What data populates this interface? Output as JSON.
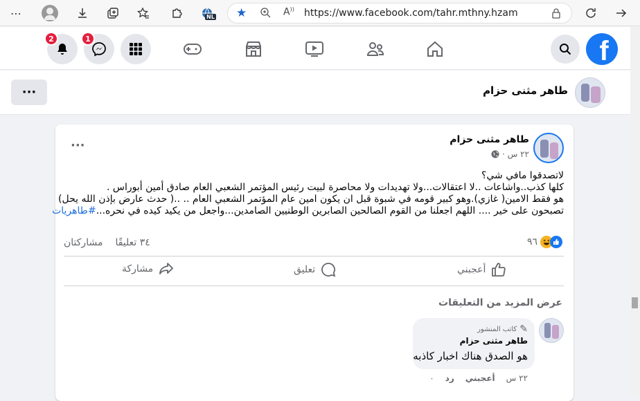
{
  "browser": {
    "url": "https://www.facebook.com/tahr.mthny.hzam",
    "lang_badge": "NL"
  },
  "fb_nav": {
    "notifications_count": "2",
    "messenger_count": "1"
  },
  "profile_header": {
    "name": "طاهر مثنى حزام",
    "more_label": "···"
  },
  "post": {
    "author": "طاهر مثنى حزام",
    "time": "٢٢ س ·",
    "more_label": "···",
    "lines": [
      "لاتصدقوا مافي شي؟",
      "كلها كذب..واشاعات ..لا اعتقالات...ولا تهديدات ولا محاصرة لبيت رئيس المؤتمر الشعبي العام صادق أمين أبوراس .",
      "هو فقط الامين( غازي).وهو كبير قومه في شبوة  قبل ان يكون امين عام المؤتمر الشعبي العام .. ..( حدث عارض بإذن الله يحل)",
      "تصبحون على خير .... اللهم اجعلنا من القوم  الصالحين الصابرين الوطنيين الصامدين...واجعل من يكيد كيده في نحره..."
    ],
    "hashtag": "#طاهريات",
    "reactions_count": "٩٦",
    "comments_count": "٣٤ تعليقًا",
    "shares_label": "مشاركتان",
    "like_label": "أعجبني",
    "comment_label": "تعليق",
    "share_label": "مشاركة",
    "more_comments": "عرض المزيد من التعليقات"
  },
  "comment": {
    "author_badge": "كاتب المنشور",
    "author": "طاهر مثنى حزام",
    "text": "هو الصدق هناك اخبار كاذبه",
    "time": "٢٢ س",
    "like": "أعجبني",
    "reply": "رد",
    "count": "٠"
  },
  "colors": {
    "facebook_blue": "#1877f2",
    "badge_red": "#e41e3f",
    "link_blue": "#216fdb"
  }
}
